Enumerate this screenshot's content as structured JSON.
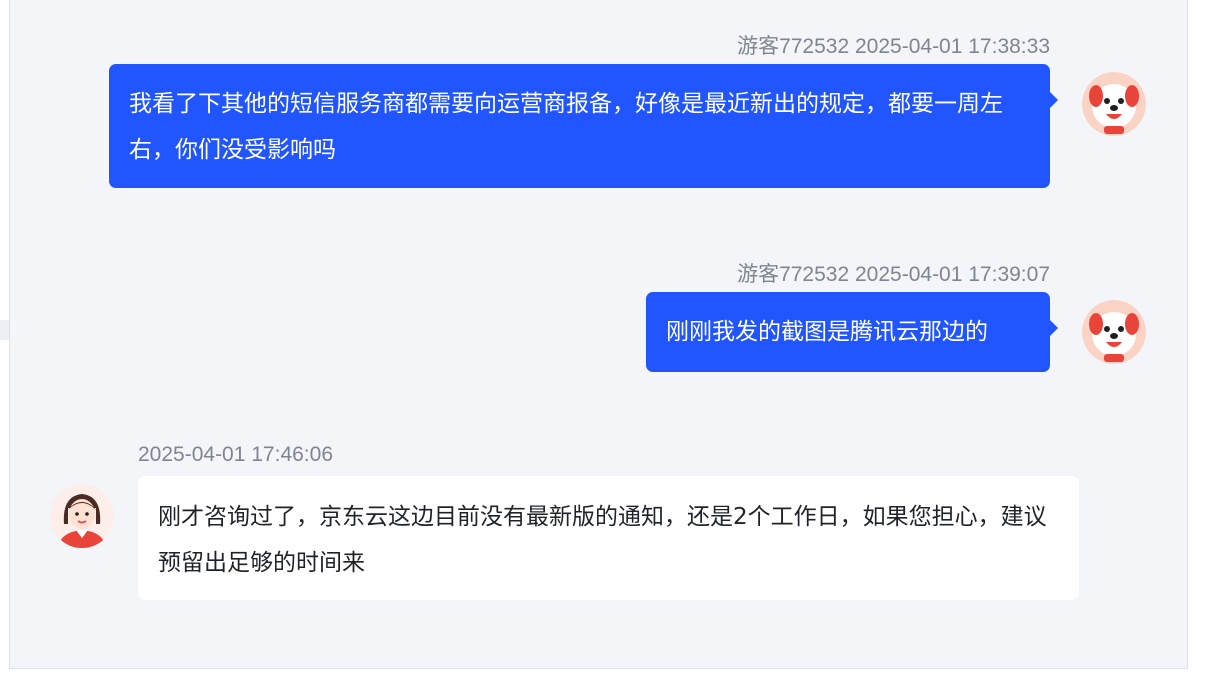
{
  "messages": [
    {
      "sender": "游客772532",
      "time": "2025-04-01 17:38:33",
      "text": "我看了下其他的短信服务商都需要向运营商报备，好像是最近新出的规定，都要一周左右，你们没受影响吗",
      "direction": "outgoing",
      "avatar_icon": "joy-dog-avatar-icon"
    },
    {
      "sender": "游客772532",
      "time": "2025-04-01 17:39:07",
      "text": "刚刚我发的截图是腾讯云那边的",
      "direction": "outgoing",
      "avatar_icon": "joy-dog-avatar-icon"
    },
    {
      "sender": "",
      "time": "2025-04-01 17:46:06",
      "text": "刚才咨询过了，京东云这边目前没有最新版的通知，还是2个工作日，如果您担心，建议预留出足够的时间来",
      "direction": "incoming",
      "avatar_icon": "agent-avatar-icon"
    }
  ],
  "colors": {
    "outgoing_bubble": "#2155ff",
    "incoming_bubble": "#ffffff",
    "background": "#f3f5f9",
    "meta_text": "#7f8590"
  }
}
